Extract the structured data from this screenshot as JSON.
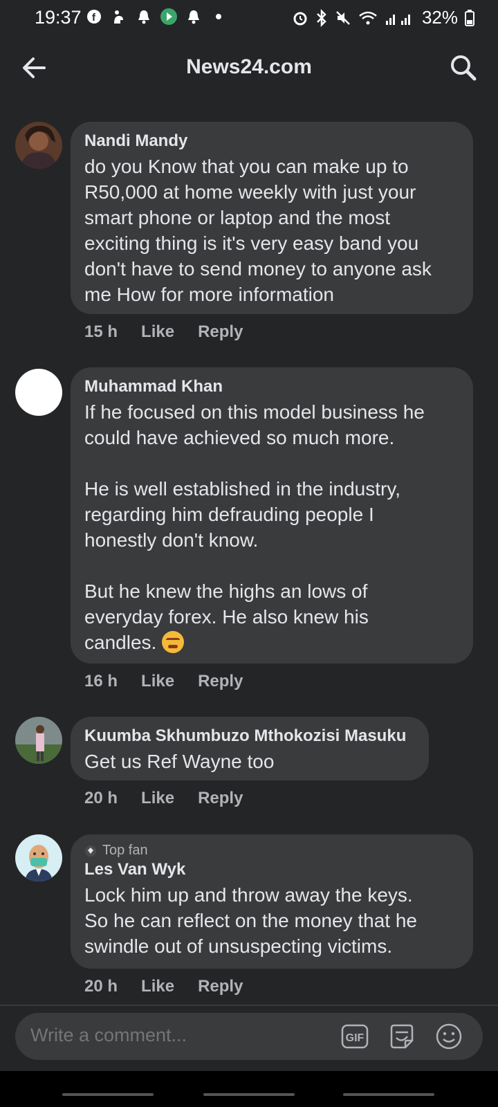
{
  "status_bar": {
    "time": "19:37",
    "battery": "32%"
  },
  "header": {
    "title": "News24.com"
  },
  "comments": [
    {
      "author": "Nandi Mandy",
      "text": "do you Know that you can make up to\nR50,000 at home weekly with just your\nsmart phone or laptop and the most\nexciting thing is it's very easy band you\ndon't have to send money to anyone ask\nme How for more information",
      "time": "15 h",
      "like": "Like",
      "reply": "Reply"
    },
    {
      "author": "Muhammad Khan",
      "text": "If he focused on this model business he\ncould have achieved so much more.\n\nHe is well established in the industry,\nregarding him defrauding people I\nhonestly don't know.\n\nBut he knew the highs an lows of\neveryday forex. He also knew his\ncandles.",
      "time": "16 h",
      "like": "Like",
      "reply": "Reply"
    },
    {
      "author": "Kuumba Skhumbuzo Mthokozisi Masuku",
      "text": "Get us Ref Wayne too",
      "time": "20 h",
      "like": "Like",
      "reply": "Reply"
    },
    {
      "badge": "Top fan",
      "author": "Les Van Wyk",
      "text": "Lock him up and throw away the keys.\nSo he can reflect on the money that he\nswindle out of unsuspecting victims.",
      "time": "20 h",
      "like": "Like",
      "reply": "Reply"
    }
  ],
  "composer": {
    "placeholder": "Write a comment...",
    "gif_label": "GIF"
  },
  "icons": {
    "back": "arrow-left-icon",
    "search": "search-icon",
    "gif": "gif-icon",
    "sticker": "sticker-icon",
    "emoji": "emoji-icon"
  },
  "colors": {
    "background": "#242526",
    "bubble": "#3a3b3c",
    "text": "#e4e6eb",
    "muted": "#b0b3b8"
  }
}
